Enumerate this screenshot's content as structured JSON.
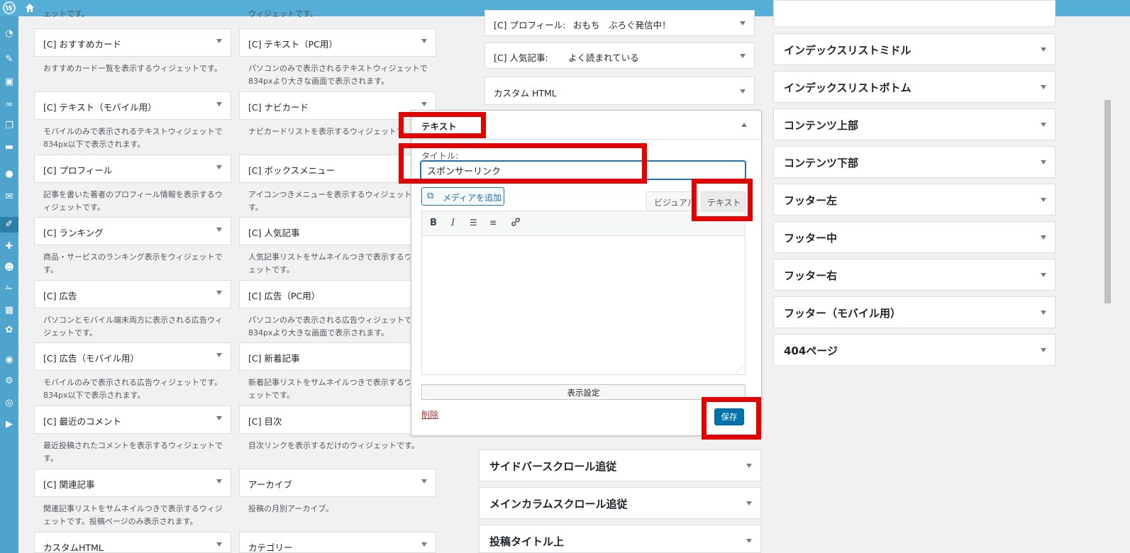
{
  "left_widgets": [
    {
      "col": 0,
      "title": "[C] おすすめカード",
      "desc1": "おすすめカード一覧を表示するウィジェットです。",
      "desc2": ""
    },
    {
      "col": 1,
      "title": "[C] テキスト（PC用）",
      "desc1": "パソコンのみで表示されるテキストウィジェットです。",
      "desc2": "834pxより大きな画面で表示されます。"
    },
    {
      "col": 0,
      "title": "[C] テキスト（モバイル用）",
      "desc1": "モバイルのみで表示されるテキストウィジェットです。",
      "desc2": "834px以下で表示されます。"
    },
    {
      "col": 1,
      "title": "[C] ナビカード",
      "desc1": "ナビカードリストを表示するウィジェットで",
      "desc2": ""
    },
    {
      "col": 0,
      "title": "[C] プロフィール",
      "desc1": "記事を書いた著者のプロフィール情報を表示するウ",
      "desc2": "ィジェットです。"
    },
    {
      "col": 1,
      "title": "[C] ボックスメニュー",
      "desc1": "アイコンつきメニューを表示するウィジェットで",
      "desc2": "す。"
    },
    {
      "col": 0,
      "title": "[C] ランキング",
      "desc1": "商品・サービスのランキング表示をウィジェットで",
      "desc2": "す。"
    },
    {
      "col": 1,
      "title": "[C] 人気記事",
      "desc1": "人気記事リストをサムネイルつきで表示するウィ",
      "desc2": "ェットです。"
    },
    {
      "col": 0,
      "title": "[C] 広告",
      "desc1": "パソコンとモバイル端末両方に表示される広告ウィ",
      "desc2": "ジェットです。"
    },
    {
      "col": 1,
      "title": "[C] 広告（PC用）",
      "desc1": "パソコンのみで表示される広告ウィジェットです",
      "desc2": "834pxより大きな画面で表示されます。"
    },
    {
      "col": 0,
      "title": "[C] 広告（モバイル用）",
      "desc1": "モバイルのみで表示される広告ウィジェットです。",
      "desc2": "834px以下で表示されます。"
    },
    {
      "col": 1,
      "title": "[C] 新着記事",
      "desc1": "新着記事リストをサムネイルつきで表示するウィ",
      "desc2": "ェットです。"
    },
    {
      "col": 0,
      "title": "[C] 最近のコメント",
      "desc1": "最近投稿されたコメントを表示するウィジェットで",
      "desc2": "す。"
    },
    {
      "col": 1,
      "title": "[C] 目次",
      "desc1": "目次リンクを表示するだけのウィジェットです。",
      "desc2": ""
    },
    {
      "col": 0,
      "title": "[C] 関連記事",
      "desc1": "関連記事リストをサムネイルつきで表示するウィジ",
      "desc2": "ェットです。投稿ページのみ表示されます。"
    },
    {
      "col": 1,
      "title": "アーカイブ",
      "desc1": "投稿の月別アーカイブ。",
      "desc2": ""
    },
    {
      "col": 0,
      "title": "カスタムHTML",
      "desc1": "",
      "desc2": ""
    },
    {
      "col": 1,
      "title": "カテゴリー",
      "desc1": "",
      "desc2": ""
    }
  ],
  "left_top_partial": {
    "c0": "ェットです。",
    "c1": "ウィジェットです。"
  },
  "sidebar_widgets": [
    {
      "title": "[C] プロフィール:",
      "subtitle": "おもち　ぶろぐ発信中！"
    },
    {
      "title": "[C] 人気記事:",
      "subtitle": "よく読まれている"
    },
    {
      "title": "カスタム HTML",
      "subtitle": ""
    }
  ],
  "editor": {
    "widget_title": "テキスト",
    "title_label": "タイトル:",
    "title_value": "スポンサーリンク",
    "add_media_label": "メディアを追加",
    "tab_visual": "ビジュアル",
    "tab_text": "テキスト",
    "toolbar": {
      "bold": "B",
      "italic": "I"
    },
    "display_settings": "表示設定",
    "delete_link": "削除",
    "save_button": "保存"
  },
  "middle_areas": [
    "サイドバースクロール追従",
    "メインカラムスクロール追従",
    "投稿タイトル上"
  ],
  "right_areas": [
    "インデックスリストミドル",
    "インデックスリストボトム",
    "コンテンツ上部",
    "コンテンツ下部",
    "フッター左",
    "フッター中",
    "フッター右",
    "フッター（モバイル用）",
    "404ページ"
  ],
  "colors": {
    "accent": "#0073aa",
    "highlight": "#e50000",
    "adminbar": "#54aed6"
  },
  "icons": {
    "adminbar": [
      "wordpress-icon",
      "home-icon"
    ]
  }
}
